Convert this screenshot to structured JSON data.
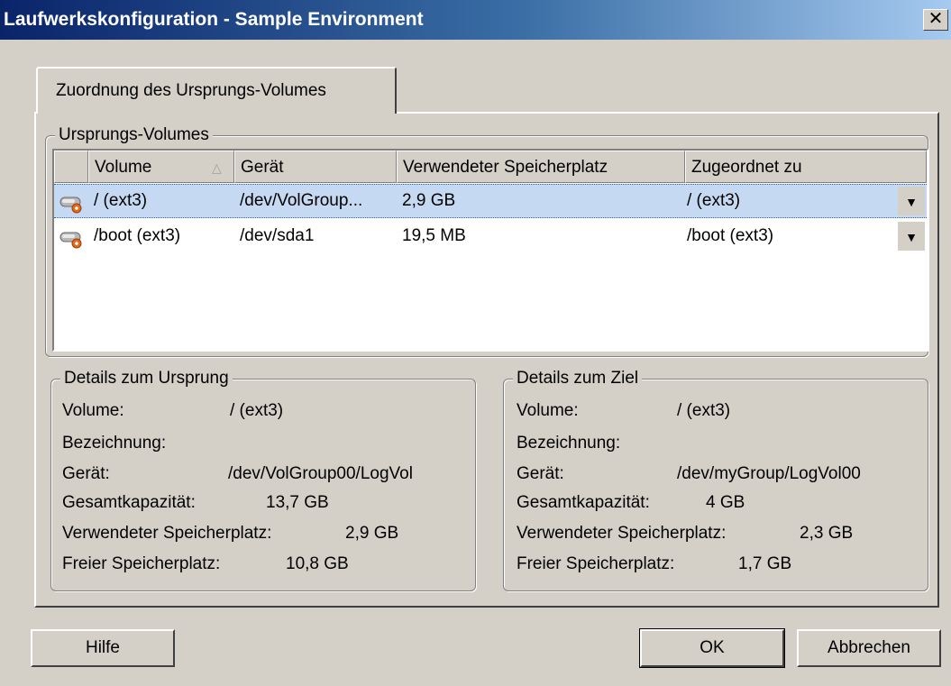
{
  "window": {
    "title": "Laufwerkskonfiguration - Sample Environment",
    "close_label": "✕"
  },
  "tab": {
    "label": "Zuordnung des Ursprungs-Volumes"
  },
  "source_volumes": {
    "group_title": "Ursprungs-Volumes",
    "columns": [
      "Volume",
      "Gerät",
      "Verwendeter Speicherplatz",
      "Zugeordnet zu"
    ],
    "sort_indicator": "△",
    "rows": [
      {
        "icon": "disk-icon",
        "volume": "/ (ext3)",
        "device": "/dev/VolGroup...",
        "used": "2,9 GB",
        "assigned": "/ (ext3)",
        "selected": true
      },
      {
        "icon": "disk-icon",
        "volume": "/boot (ext3)",
        "device": "/dev/sda1",
        "used": "19,5 MB",
        "assigned": "/boot (ext3)",
        "selected": false
      }
    ],
    "dropdown_glyph": "▼"
  },
  "source_details": {
    "title": "Details zum Ursprung",
    "volume_label": "Volume:",
    "volume": "/ (ext3)",
    "name_label": "Bezeichnung:",
    "device_label": "Gerät:",
    "device": "/dev/VolGroup00/LogVol",
    "capacity_label": "Gesamtkapazität:",
    "capacity": "13,7 GB",
    "used_label": "Verwendeter Speicherplatz:",
    "used": "2,9 GB",
    "free_label": "Freier Speicherplatz:",
    "free": "10,8 GB"
  },
  "target_details": {
    "title": "Details zum Ziel",
    "volume_label": "Volume:",
    "volume": "/ (ext3)",
    "name_label": "Bezeichnung:",
    "device_label": "Gerät:",
    "device": "/dev/myGroup/LogVol00",
    "capacity_label": "Gesamtkapazität:",
    "capacity": "4 GB",
    "used_label": "Verwendeter Speicherplatz:",
    "used": "2,3 GB",
    "free_label": "Freier Speicherplatz:",
    "free": "1,7 GB"
  },
  "buttons": {
    "help": "Hilfe",
    "ok": "OK",
    "cancel": "Abbrechen"
  },
  "colors": {
    "title_gradient_start": "#0a246a",
    "title_gradient_end": "#a6caf0",
    "selection": "#c5d9f2",
    "dialog_bg": "#d4d0c8"
  }
}
